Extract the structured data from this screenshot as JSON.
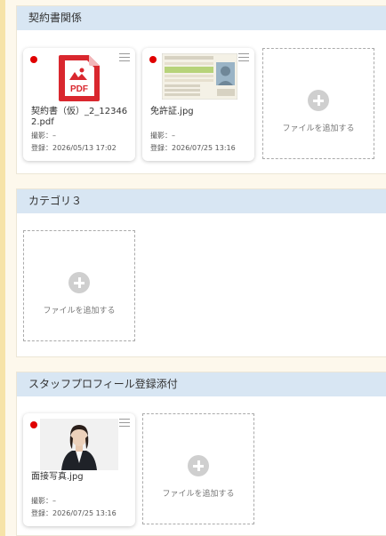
{
  "sections": [
    {
      "title": "契約書関係",
      "files": [
        {
          "icon": "pdf-file-icon",
          "badge": "PDF",
          "name": "契約書（仮）_2_123462.pdf",
          "photo_label": "撮影：–",
          "registered_label": "登録：2026/05/13 17:02",
          "status_color": "#e00000"
        },
        {
          "icon": "license-image-thumbnail",
          "name": "免許証.jpg",
          "photo_label": "撮影：–",
          "registered_label": "登録：2026/07/25 13:16",
          "status_color": "#e00000"
        }
      ],
      "add_label": "ファイルを追加する"
    },
    {
      "title": "カテゴリ３",
      "files": [],
      "add_label": "ファイルを追加する"
    },
    {
      "title": "スタッフプロフィール登録添付",
      "files": [
        {
          "icon": "portrait-image-thumbnail",
          "name": "面接写真.jpg",
          "photo_label": "撮影：–",
          "registered_label": "登録：2026/07/25 13:16",
          "status_color": "#e00000"
        }
      ],
      "add_label": "ファイルを追加する"
    }
  ],
  "colors": {
    "header_bg": "#d8e6f3",
    "page_bg": "#fdf8ec",
    "pdf_red": "#d9272e",
    "status_dot": "#e00000"
  }
}
